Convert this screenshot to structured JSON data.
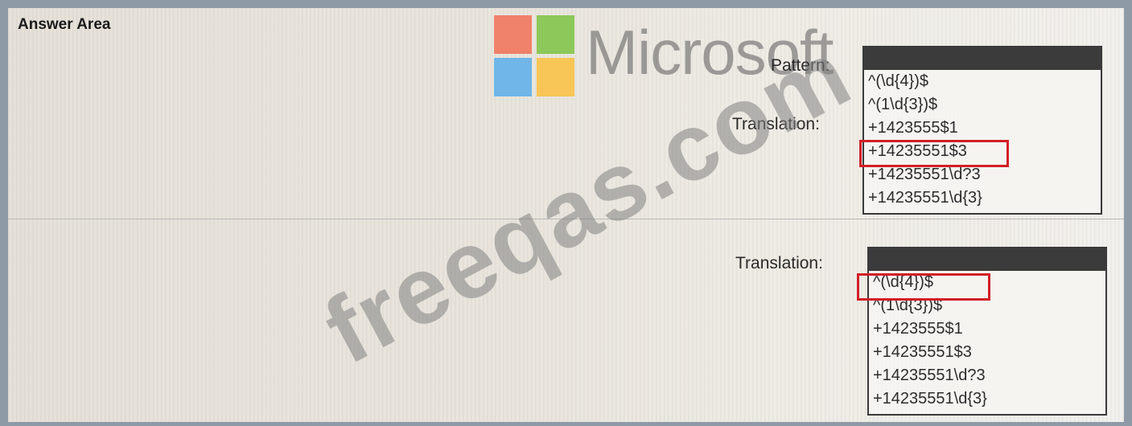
{
  "answer_area": {
    "title": "Answer Area"
  },
  "watermark": {
    "brand": "Microsoft",
    "site": "freeqas.com"
  },
  "logo_colors": [
    "#f0816b",
    "#8cc85a",
    "#70b6e8",
    "#f7c657"
  ],
  "highlight_color": "#d21f26",
  "section1": {
    "pattern_label": "Pattern:",
    "translation_label": "Translation:",
    "options": [
      "^(\\d{4})$",
      "^(1\\d{3})$",
      "+1423555$1",
      "+14235551$3",
      "+14235551\\d?3",
      "+14235551\\d{3}"
    ],
    "selected": "+14235551$3"
  },
  "section2": {
    "translation_label": "Translation:",
    "options": [
      "^(\\d{4})$",
      "^(1\\d{3})$",
      "+1423555$1",
      "+14235551$3",
      "+14235551\\d?3",
      "+14235551\\d{3}"
    ],
    "selected": "^(\\d{4})$"
  }
}
